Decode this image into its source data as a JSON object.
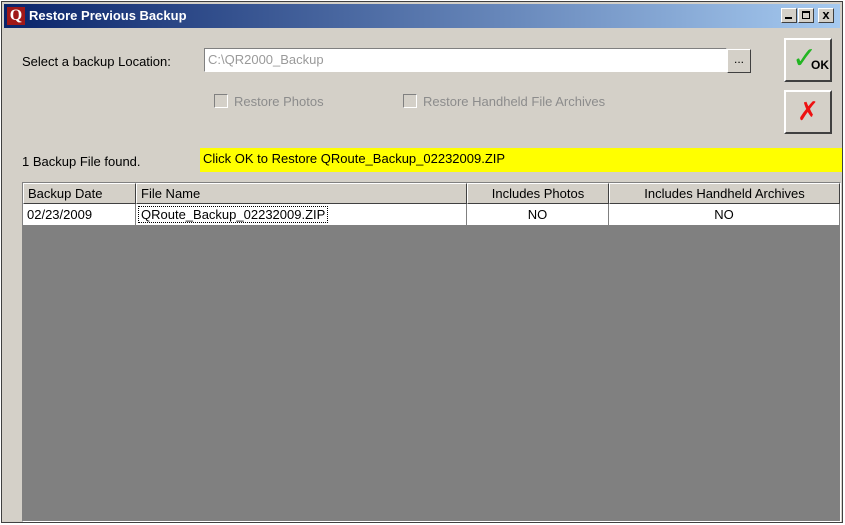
{
  "window": {
    "app_icon_letter": "Q",
    "title": "Restore Previous Backup",
    "controls": {
      "minimize": "_",
      "maximize": "□",
      "close": "x"
    }
  },
  "location": {
    "label": "Select a backup Location:",
    "value": "C:\\QR2000_Backup",
    "browse_label": "..."
  },
  "options": {
    "restore_photos": {
      "label": "Restore Photos",
      "checked": false,
      "enabled": false
    },
    "restore_archives": {
      "label": "Restore Handheld File Archives",
      "checked": false,
      "enabled": false
    }
  },
  "buttons": {
    "ok_label": "OK",
    "ok_icon": "checkmark-icon",
    "cancel_icon": "red-x-icon",
    "ok_color": "#22b522",
    "cancel_color": "#ee1111"
  },
  "status": {
    "found_text": "1 Backup File found.",
    "banner_text": "Click OK to Restore QRoute_Backup_02232009.ZIP",
    "banner_color": "#ffff00"
  },
  "table": {
    "columns": [
      "Backup Date",
      "File Name",
      "Includes Photos",
      "Includes Handheld Archives"
    ],
    "rows": [
      {
        "date": "02/23/2009",
        "file": "QRoute_Backup_02232009.ZIP",
        "photos": "NO",
        "archives": "NO"
      }
    ]
  }
}
